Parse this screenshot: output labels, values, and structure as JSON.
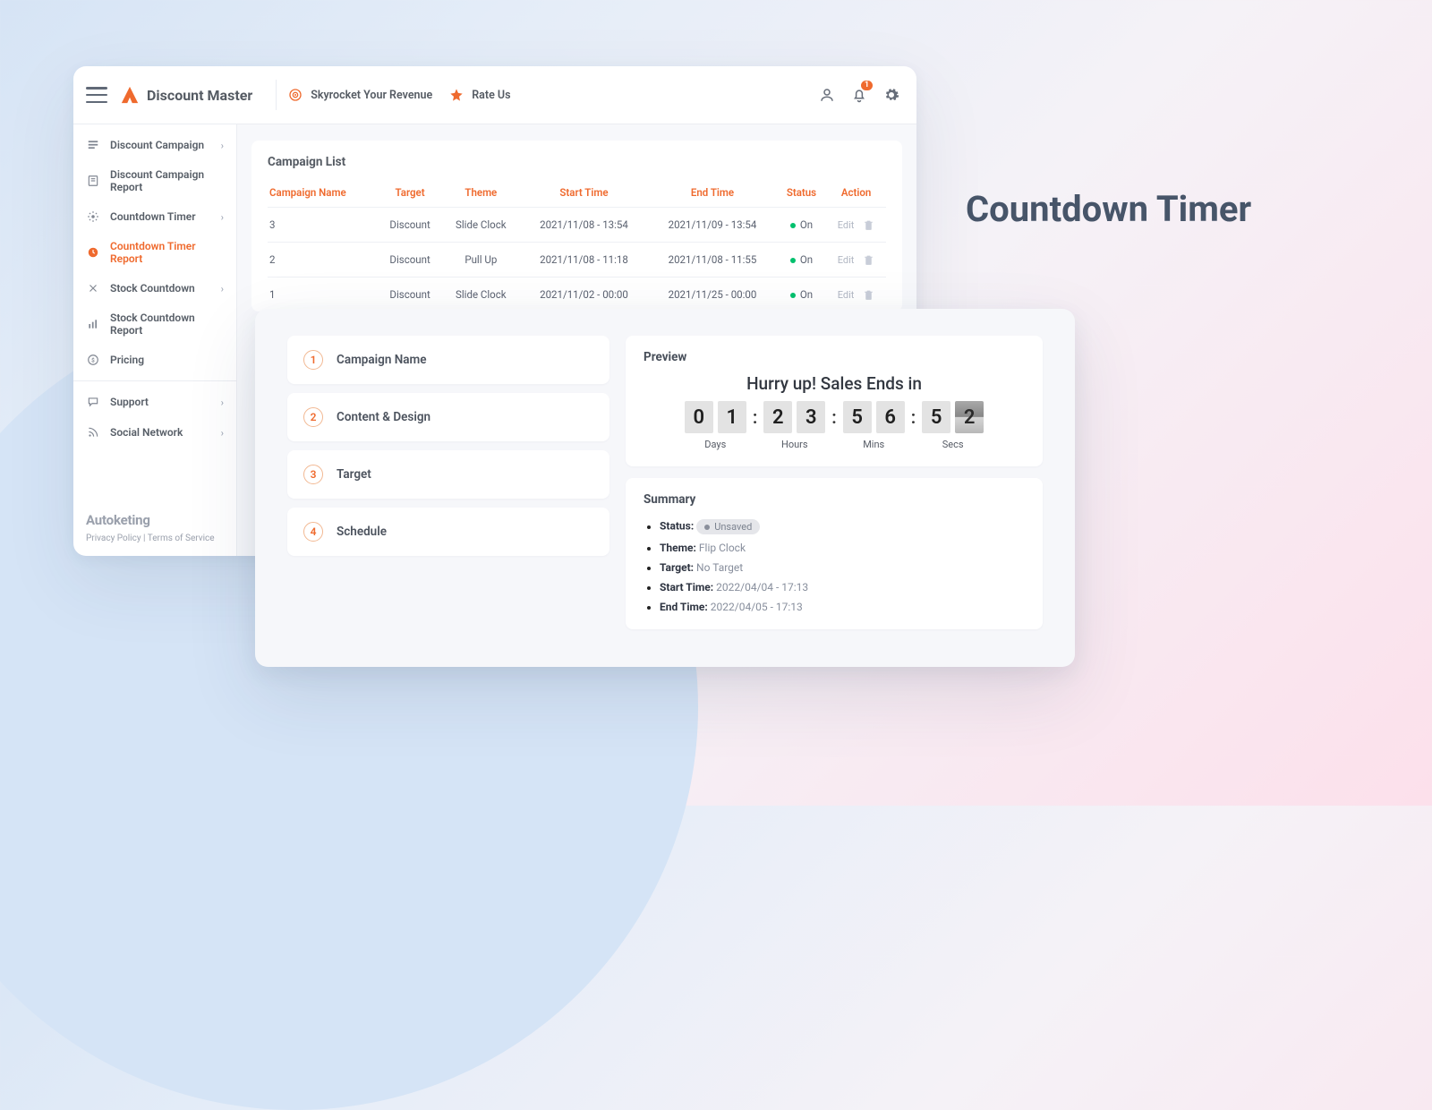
{
  "page_title": "Countdown Timer",
  "brand": "Discount Master",
  "header": {
    "revenue_label": "Skyrocket Your Revenue",
    "rate_label": "Rate Us",
    "notif_count": "1"
  },
  "sidebar": {
    "items": [
      {
        "label": "Discount Campaign",
        "expandable": true
      },
      {
        "label": "Discount Campaign Report",
        "expandable": false
      },
      {
        "label": "Countdown Timer",
        "expandable": true
      },
      {
        "label": "Countdown Timer Report",
        "expandable": false,
        "active": true
      },
      {
        "label": "Stock Countdown",
        "expandable": true
      },
      {
        "label": "Stock Countdown Report",
        "expandable": false
      },
      {
        "label": "Pricing",
        "expandable": false
      }
    ],
    "lower": [
      {
        "label": "Support",
        "expandable": true
      },
      {
        "label": "Social Network",
        "expandable": true
      }
    ],
    "footer_brand": "Autoketing",
    "footer_links": "Privacy Policy | Terms of Service"
  },
  "campaign_list": {
    "title": "Campaign List",
    "columns": [
      "Campaign Name",
      "Target",
      "Theme",
      "Start Time",
      "End Time",
      "Status",
      "Action"
    ],
    "rows": [
      {
        "name": "3",
        "target": "Discount",
        "theme": "Slide Clock",
        "start": "2021/11/08 - 13:54",
        "end": "2021/11/09 - 13:54",
        "status": "On",
        "edit": "Edit"
      },
      {
        "name": "2",
        "target": "Discount",
        "theme": "Pull Up",
        "start": "2021/11/08 - 11:18",
        "end": "2021/11/08 - 11:55",
        "status": "On",
        "edit": "Edit"
      },
      {
        "name": "1",
        "target": "Discount",
        "theme": "Slide Clock",
        "start": "2021/11/02 - 00:00",
        "end": "2021/11/25 - 00:00",
        "status": "On",
        "edit": "Edit"
      }
    ]
  },
  "steps": [
    {
      "num": "1",
      "label": "Campaign Name"
    },
    {
      "num": "2",
      "label": "Content & Design"
    },
    {
      "num": "3",
      "label": "Target"
    },
    {
      "num": "4",
      "label": "Schedule"
    }
  ],
  "preview": {
    "title": "Preview",
    "heading": "Hurry up! Sales Ends in",
    "days": [
      "0",
      "1"
    ],
    "hours": [
      "2",
      "3"
    ],
    "mins": [
      "5",
      "6"
    ],
    "secs": [
      "5",
      "2"
    ],
    "labels": {
      "days": "Days",
      "hours": "Hours",
      "mins": "Mins",
      "secs": "Secs"
    }
  },
  "summary": {
    "title": "Summary",
    "status_label": "Status:",
    "status_value": "Unsaved",
    "theme_label": "Theme:",
    "theme_value": "Flip Clock",
    "target_label": "Target:",
    "target_value": "No Target",
    "start_label": "Start Time:",
    "start_value": "2022/04/04 - 17:13",
    "end_label": "End Time:",
    "end_value": "2022/04/05 - 17:13"
  }
}
